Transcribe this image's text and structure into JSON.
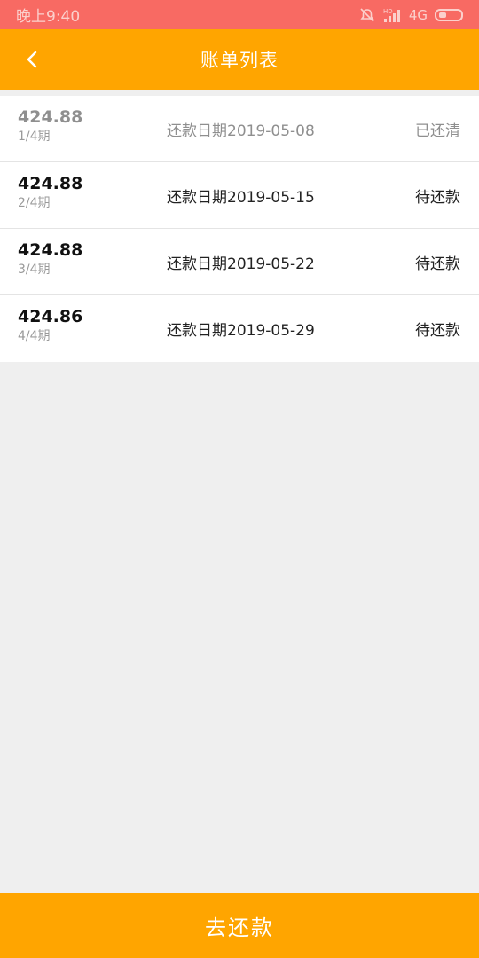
{
  "status_bar": {
    "time": "晚上9:40",
    "network": "4G",
    "hd_label": "HD",
    "icons": [
      "alarm-off-icon",
      "signal-icon",
      "battery-icon"
    ]
  },
  "header": {
    "title": "账单列表",
    "back_icon": "chevron-left-icon",
    "color": "#ffa500"
  },
  "bills": [
    {
      "amount": "424.88",
      "period": "1/4期",
      "date": "还款日期2019-05-08",
      "status": "已还清",
      "paid": true
    },
    {
      "amount": "424.88",
      "period": "2/4期",
      "date": "还款日期2019-05-15",
      "status": "待还款",
      "paid": false
    },
    {
      "amount": "424.88",
      "period": "3/4期",
      "date": "还款日期2019-05-22",
      "status": "待还款",
      "paid": false
    },
    {
      "amount": "424.86",
      "period": "4/4期",
      "date": "还款日期2019-05-29",
      "status": "待还款",
      "paid": false
    }
  ],
  "footer": {
    "pay_label": "去还款"
  }
}
